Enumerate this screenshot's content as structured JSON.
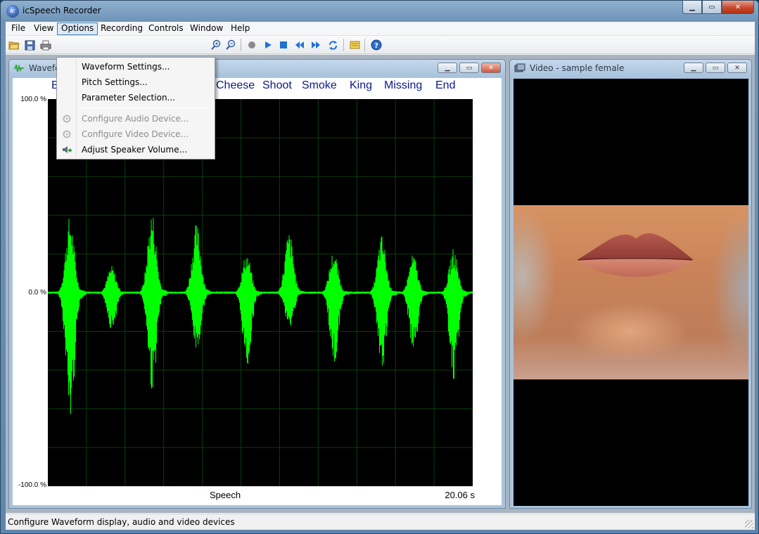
{
  "app": {
    "title": "icSpeech Recorder",
    "icon_glyph": "ic"
  },
  "menubar": [
    "File",
    "View",
    "Options",
    "Recording",
    "Controls",
    "Window",
    "Help"
  ],
  "options_menu": {
    "waveform_settings": "Waveform Settings...",
    "pitch_settings": "Pitch Settings...",
    "parameter_selection": "Parameter Selection...",
    "configure_audio": "Configure Audio Device...",
    "configure_video": "Configure Video Device...",
    "adjust_speaker": "Adjust Speaker Volume..."
  },
  "waveform_window": {
    "title": "Wavefo",
    "words": [
      "B",
      "Cheese",
      "Shoot",
      "Smoke",
      "King",
      "Missing",
      "End"
    ],
    "y_top": "100.0 %",
    "y_mid": "0.0 %",
    "y_bottom": "-100.0 %",
    "x_label": "Speech",
    "duration": "20.06 s",
    "wave_color": "#00ff00"
  },
  "video_window": {
    "title": "Video - sample female"
  },
  "statusbar": {
    "text": "Configure Waveform display, audio and video devices"
  },
  "chart_data": {
    "type": "line",
    "ylim": [
      -100,
      100
    ],
    "xlabel": "Speech",
    "duration_s": 20.06,
    "bursts": [
      {
        "pos": 0.052,
        "up": 40,
        "down": 68
      },
      {
        "pos": 0.15,
        "up": 14,
        "down": 20
      },
      {
        "pos": 0.245,
        "up": 43,
        "down": 52
      },
      {
        "pos": 0.35,
        "up": 36,
        "down": 32
      },
      {
        "pos": 0.468,
        "up": 21,
        "down": 40
      },
      {
        "pos": 0.568,
        "up": 32,
        "down": 20
      },
      {
        "pos": 0.673,
        "up": 22,
        "down": 38
      },
      {
        "pos": 0.786,
        "up": 30,
        "down": 42
      },
      {
        "pos": 0.86,
        "up": 20,
        "down": 32
      },
      {
        "pos": 0.955,
        "up": 23,
        "down": 48
      }
    ]
  }
}
